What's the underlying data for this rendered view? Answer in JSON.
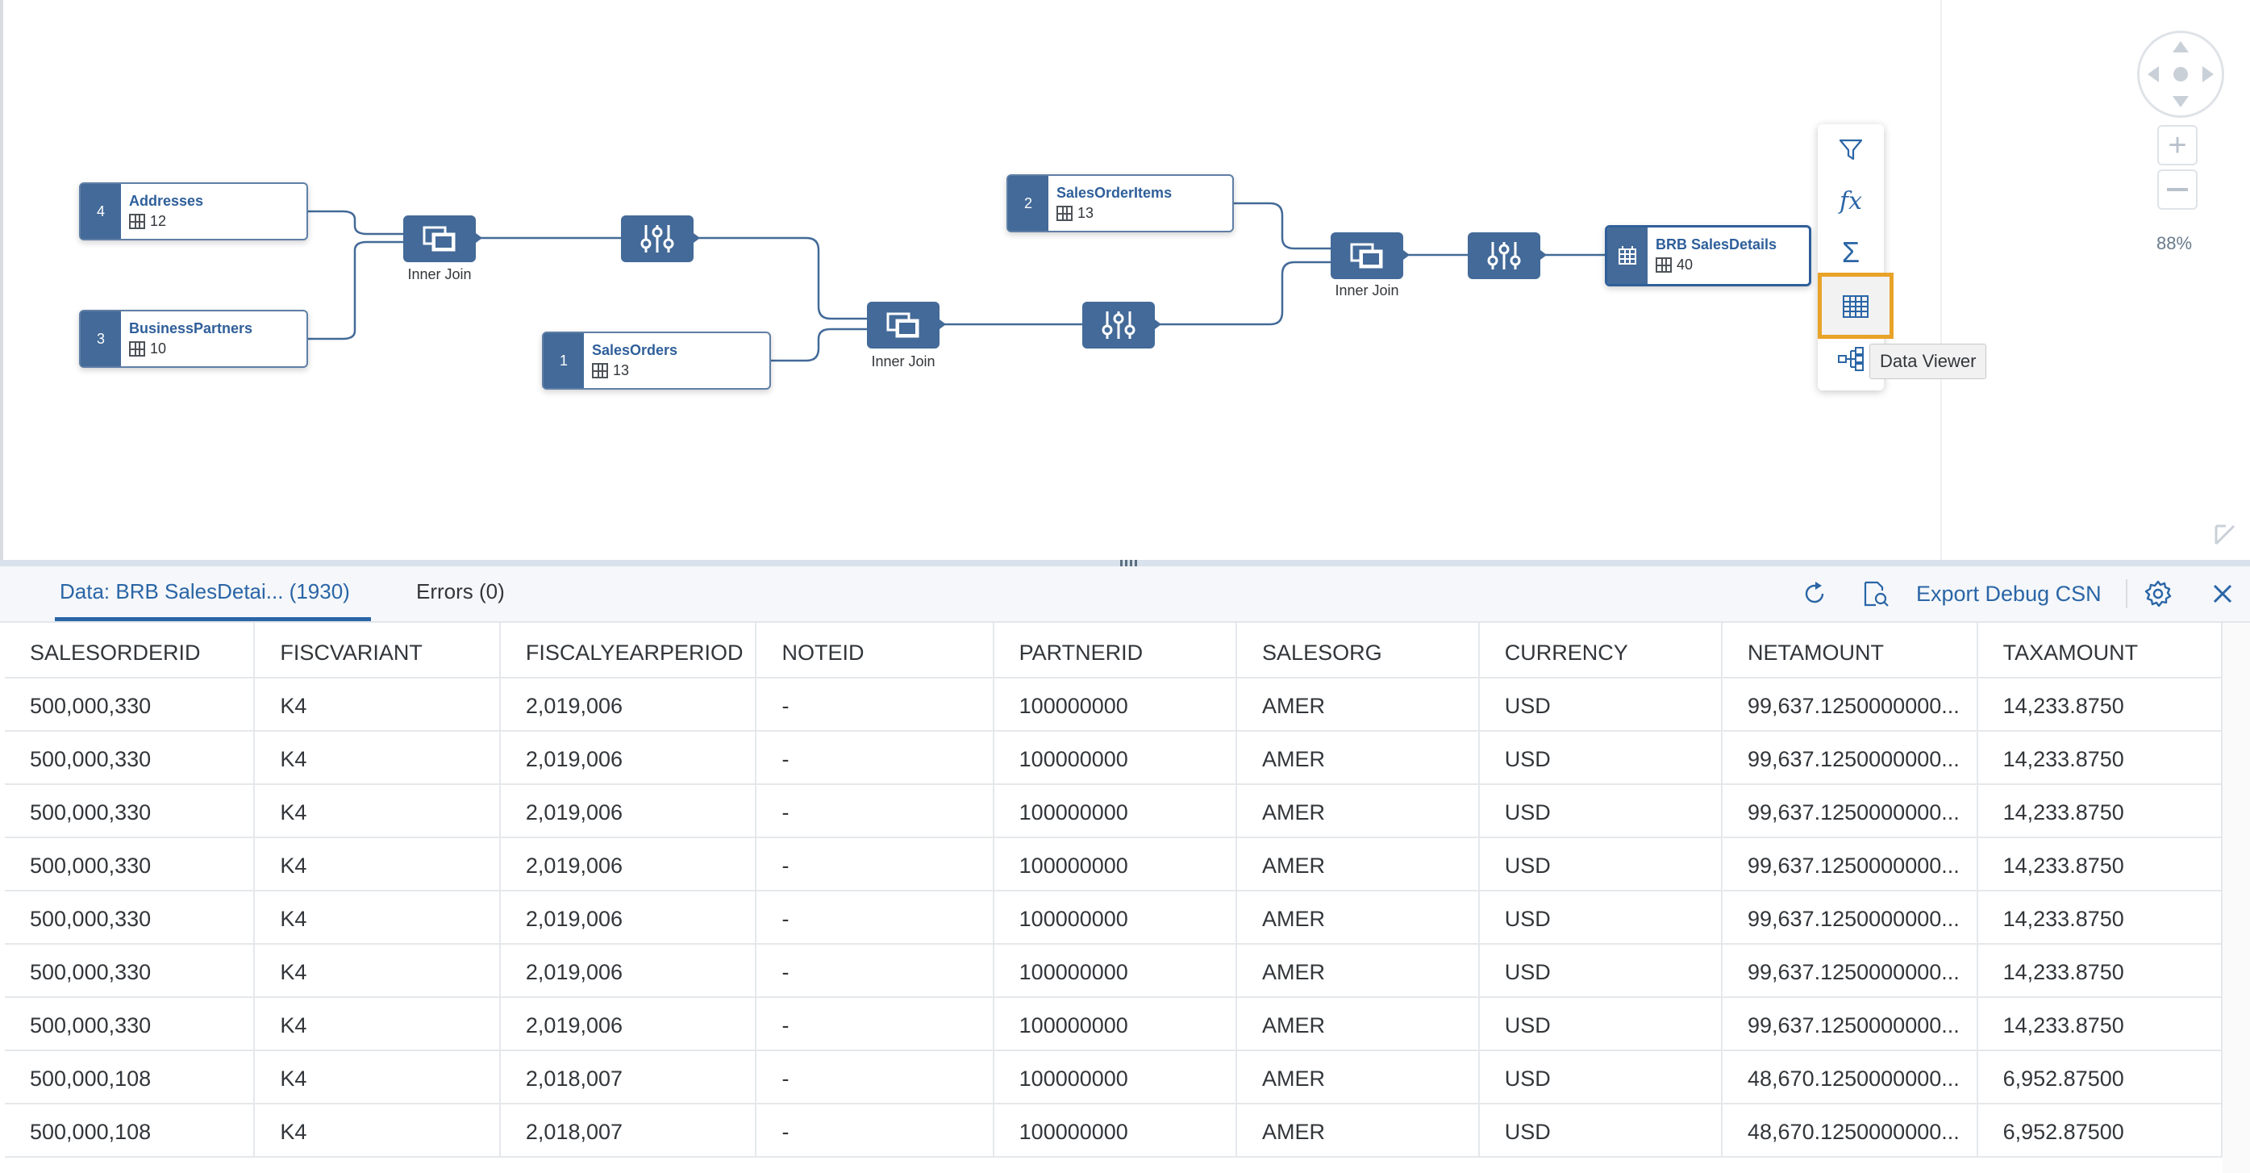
{
  "canvas": {
    "sources": [
      {
        "num": "4",
        "name": "Addresses",
        "columns": "12"
      },
      {
        "num": "3",
        "name": "BusinessPartners",
        "columns": "10"
      },
      {
        "num": "1",
        "name": "SalesOrders",
        "columns": "13"
      },
      {
        "num": "2",
        "name": "SalesOrderItems",
        "columns": "13"
      }
    ],
    "joins": [
      "Inner Join",
      "Inner Join",
      "Inner Join"
    ],
    "target": {
      "name": "BRB SalesDetails",
      "columns": "40"
    },
    "tooltip": "Data Viewer",
    "zoom": "88%"
  },
  "panel": {
    "tab_data": "Data: BRB SalesDetai... (1930)",
    "tab_errors": "Errors (0)",
    "export_label": "Export Debug CSN",
    "columns": [
      "SALESORDERID",
      "FISCVARIANT",
      "FISCALYEARPERIOD",
      "NOTEID",
      "PARTNERID",
      "SALESORG",
      "CURRENCY",
      "NETAMOUNT",
      "TAXAMOUNT"
    ],
    "rows": [
      [
        "500,000,330",
        "K4",
        "2,019,006",
        "-",
        "100000000",
        "AMER",
        "USD",
        "99,637.1250000000...",
        "14,233.8750"
      ],
      [
        "500,000,330",
        "K4",
        "2,019,006",
        "-",
        "100000000",
        "AMER",
        "USD",
        "99,637.1250000000...",
        "14,233.8750"
      ],
      [
        "500,000,330",
        "K4",
        "2,019,006",
        "-",
        "100000000",
        "AMER",
        "USD",
        "99,637.1250000000...",
        "14,233.8750"
      ],
      [
        "500,000,330",
        "K4",
        "2,019,006",
        "-",
        "100000000",
        "AMER",
        "USD",
        "99,637.1250000000...",
        "14,233.8750"
      ],
      [
        "500,000,330",
        "K4",
        "2,019,006",
        "-",
        "100000000",
        "AMER",
        "USD",
        "99,637.1250000000...",
        "14,233.8750"
      ],
      [
        "500,000,330",
        "K4",
        "2,019,006",
        "-",
        "100000000",
        "AMER",
        "USD",
        "99,637.1250000000...",
        "14,233.8750"
      ],
      [
        "500,000,330",
        "K4",
        "2,019,006",
        "-",
        "100000000",
        "AMER",
        "USD",
        "99,637.1250000000...",
        "14,233.8750"
      ],
      [
        "500,000,108",
        "K4",
        "2,018,007",
        "-",
        "100000000",
        "AMER",
        "USD",
        "48,670.1250000000...",
        "6,952.87500"
      ],
      [
        "500,000,108",
        "K4",
        "2,018,007",
        "-",
        "100000000",
        "AMER",
        "USD",
        "48,670.1250000000...",
        "6,952.87500"
      ]
    ]
  },
  "colors": {
    "accent": "#436a98",
    "link": "#2a65a6",
    "highlight": "#e8a328"
  },
  "icons": [
    "filter-icon",
    "function-icon",
    "sum-icon",
    "data-viewer-icon",
    "lineage-icon",
    "refresh-icon",
    "preview-search-icon",
    "settings-icon",
    "close-icon",
    "join-icon",
    "projection-icon",
    "navigator-icon",
    "zoom-in-icon",
    "zoom-out-icon"
  ]
}
